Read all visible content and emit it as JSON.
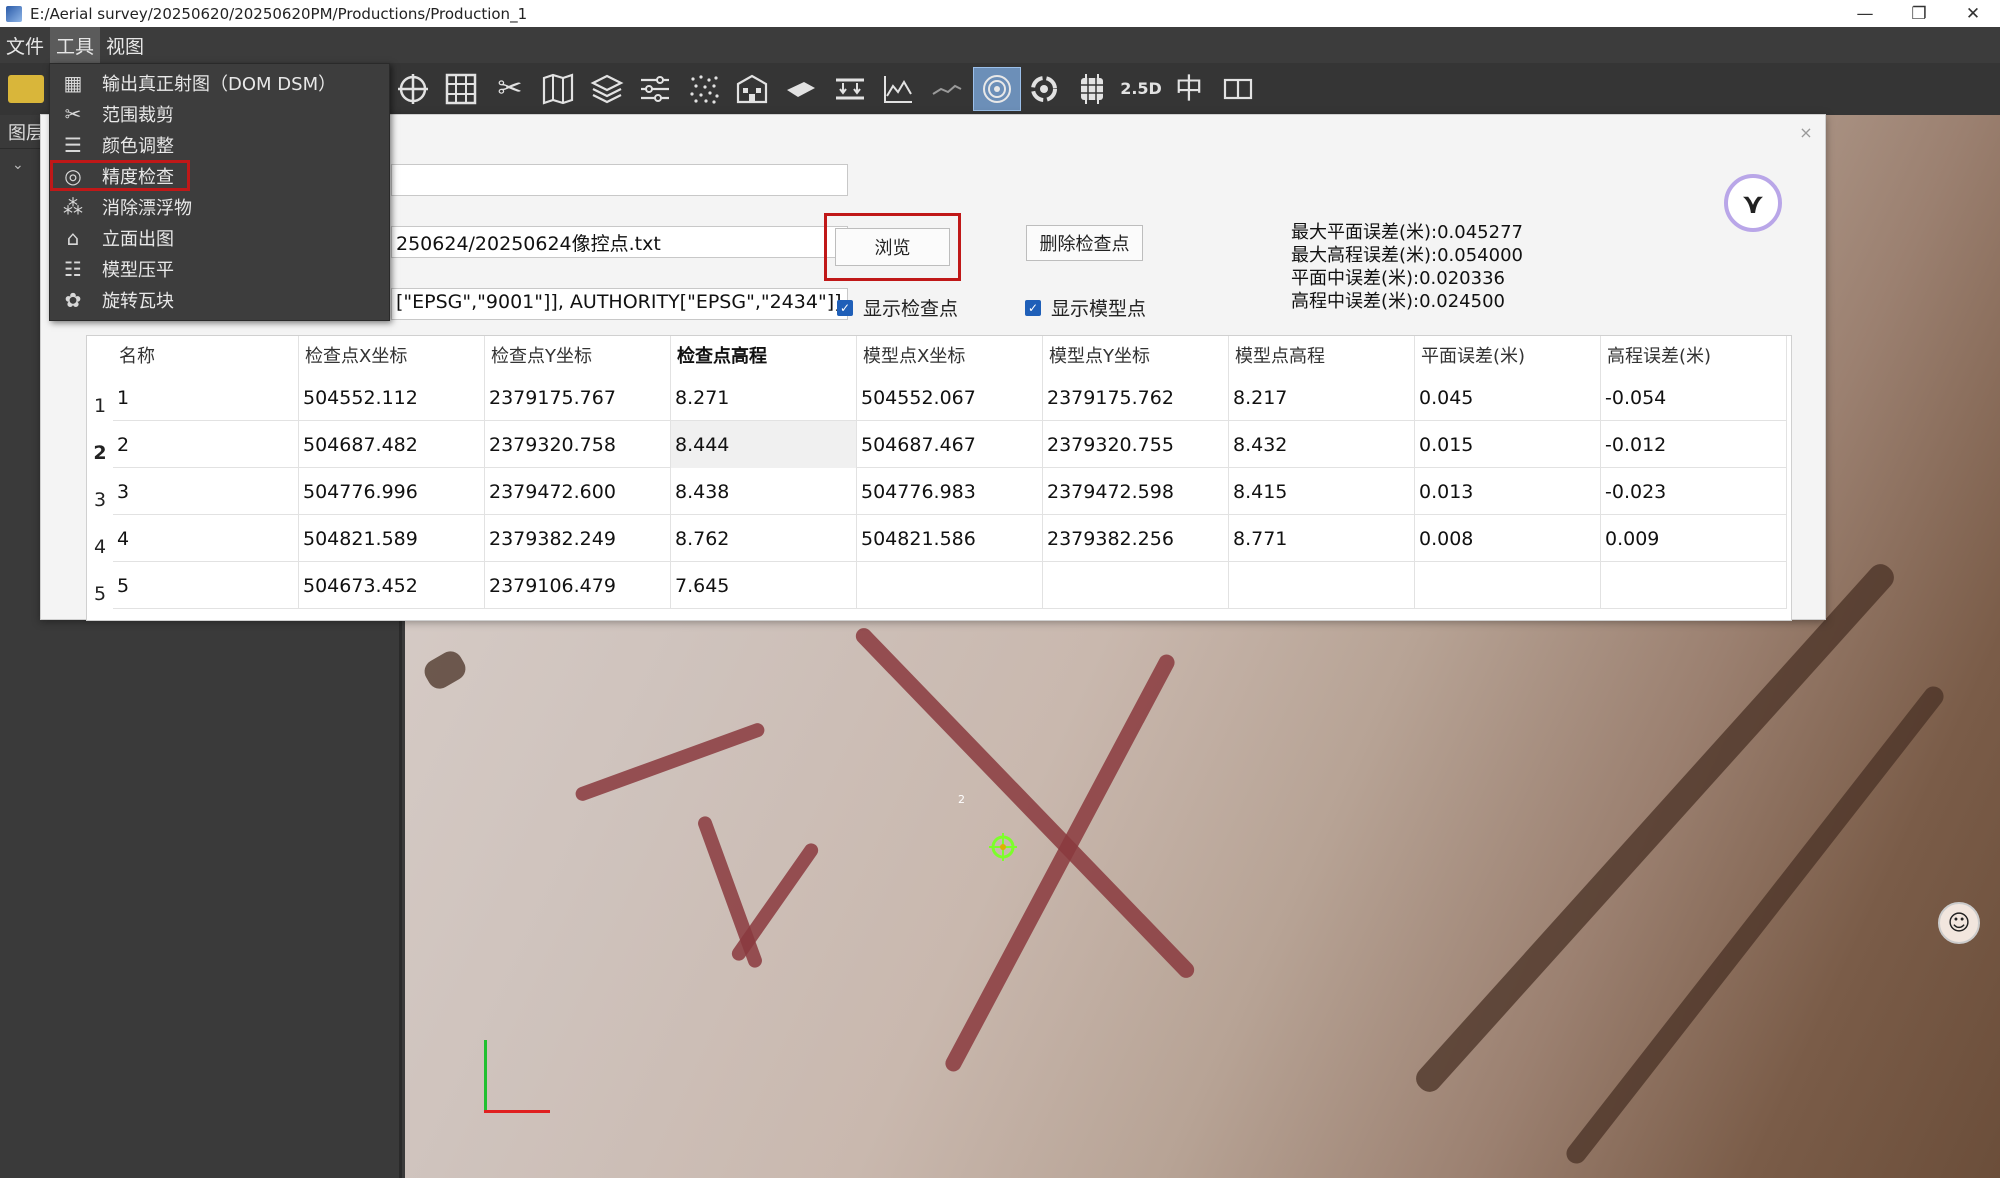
{
  "titlebar": {
    "path": "E:/Aerial survey/20250620/20250620PM/Productions/Production_1",
    "minimize": "—",
    "maximize": "❐",
    "close": "✕"
  },
  "menubar": {
    "items": [
      {
        "label": "文件"
      },
      {
        "label": "工具"
      },
      {
        "label": "视图"
      }
    ]
  },
  "toolbar": {
    "label_25d": "2.5D",
    "label_center": "中",
    "icons": [
      "target-icon",
      "grid-icon",
      "scissors-icon",
      "map-icon",
      "layers-icon",
      "sliders-icon",
      "noise-icon",
      "facade-icon",
      "flatten-icon",
      "compress-icon",
      "chart-icon",
      "line-icon",
      "accuracy-icon",
      "rotate-icon",
      "tile-icon",
      "25d-icon",
      "center-icon",
      "split-icon"
    ]
  },
  "leftpanel": {
    "header": "图层"
  },
  "dropdown": {
    "items": [
      {
        "label": "输出真正射图（DOM DSM）",
        "icon": "grid-icon"
      },
      {
        "label": "范围裁剪",
        "icon": "scissors-icon"
      },
      {
        "label": "颜色调整",
        "icon": "sliders-icon"
      },
      {
        "label": "精度检查",
        "icon": "accuracy-icon"
      },
      {
        "label": "消除漂浮物",
        "icon": "noise-icon"
      },
      {
        "label": "立面出图",
        "icon": "facade-icon"
      },
      {
        "label": "模型压平",
        "icon": "flatten-icon"
      },
      {
        "label": "旋转瓦块",
        "icon": "rotate-icon"
      }
    ]
  },
  "dialog": {
    "field1": "",
    "file_path": "250624/20250624像控点.txt",
    "crs": "[\"EPSG\",\"9001\"]],    AUTHORITY[\"EPSG\",\"2434\"]]",
    "browse_label": "浏览",
    "delete_label": "删除检查点",
    "show_check_label": "显示检查点",
    "show_model_label": "显示模型点",
    "close_label": "×",
    "stats": {
      "max_plane": "最大平面误差(米):0.045277",
      "max_height": "最大高程误差(米):0.054000",
      "plane_rmse": "平面中误差(米):0.020336",
      "height_rmse": "高程中误差(米):0.024500"
    }
  },
  "table": {
    "headers": [
      "名称",
      "检查点X坐标",
      "检查点Y坐标",
      "检查点高程",
      "模型点X坐标",
      "模型点Y坐标",
      "模型点高程",
      "平面误差(米)",
      "高程误差(米)"
    ],
    "rows": [
      {
        "idx": "1",
        "cells": [
          "1",
          "504552.112",
          "2379175.767",
          "8.271",
          "504552.067",
          "2379175.762",
          "8.217",
          "0.045",
          "-0.054"
        ]
      },
      {
        "idx": "2",
        "cells": [
          "2",
          "504687.482",
          "2379320.758",
          "8.444",
          "504687.467",
          "2379320.755",
          "8.432",
          "0.015",
          "-0.012"
        ]
      },
      {
        "idx": "3",
        "cells": [
          "3",
          "504776.996",
          "2379472.600",
          "8.438",
          "504776.983",
          "2379472.598",
          "8.415",
          "0.013",
          "-0.023"
        ]
      },
      {
        "idx": "4",
        "cells": [
          "4",
          "504821.589",
          "2379382.249",
          "8.762",
          "504821.586",
          "2379382.256",
          "8.771",
          "0.008",
          "0.009"
        ]
      },
      {
        "idx": "5",
        "cells": [
          "5",
          "504673.452",
          "2379106.479",
          "7.645",
          "",
          "",
          "",
          "",
          ""
        ]
      }
    ]
  },
  "viewport": {
    "marker_label": "2"
  },
  "colors": {
    "accent_red": "#c01818",
    "checkbox_blue": "#1f5fb8",
    "toolbar_bg": "#353535"
  }
}
